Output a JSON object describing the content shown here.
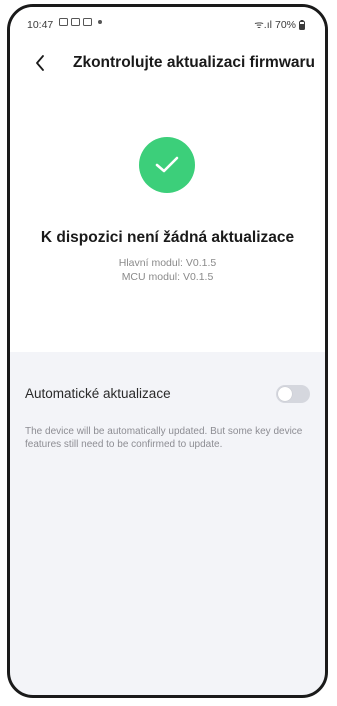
{
  "status_bar": {
    "time": "10:47",
    "signal_text": "ᯤ.ıl",
    "battery": "70%"
  },
  "header": {
    "title": "Zkontrolujte aktualizaci firmwaru"
  },
  "update_status": {
    "heading": "K dispozici není žádná aktualizace",
    "main_module": "Hlavní modul: V0.1.5",
    "mcu_module": "MCU modul: V0.1.5",
    "icon_color": "#3ccf7a"
  },
  "auto_update": {
    "label": "Automatické aktualizace",
    "enabled": false,
    "description": "The device will be automatically updated. But some key device features still need to be confirmed to update."
  }
}
